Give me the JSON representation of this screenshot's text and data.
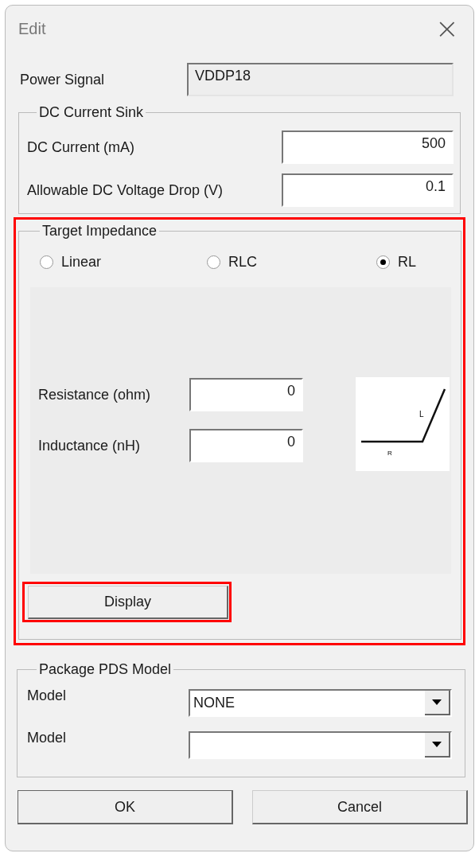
{
  "window": {
    "title": "Edit",
    "close": "×"
  },
  "power_signal": {
    "label": "Power Signal",
    "value": "VDDP18",
    "disabled": true
  },
  "dc_current_sink": {
    "title": "DC Current Sink",
    "fields": [
      {
        "label": "DC Current (mA)",
        "value": "500"
      },
      {
        "label": "Allowable DC Voltage Drop (V)",
        "value": "0.1"
      }
    ]
  },
  "target_impedance": {
    "title": "Target Impedance",
    "highlighted": true,
    "options": [
      {
        "label": "Linear",
        "selected": false
      },
      {
        "label": "RLC",
        "selected": false
      },
      {
        "label": "RL",
        "selected": true
      }
    ],
    "fields": [
      {
        "label": "Resistance (ohm)",
        "value": "0"
      },
      {
        "label": "Inductance (nH)",
        "value": "0"
      }
    ],
    "diagram": {
      "r_label": "R",
      "l_label": "L"
    },
    "display_button": {
      "label": "Display",
      "highlighted": true
    }
  },
  "package_pds_model": {
    "title": "Package PDS Model",
    "dropdowns": [
      {
        "label": "Model",
        "value": "NONE"
      },
      {
        "label": "Model"
      }
    ]
  },
  "buttons": [
    {
      "label": "OK",
      "default": true
    },
    {
      "label": "Cancel",
      "default": false
    }
  ]
}
